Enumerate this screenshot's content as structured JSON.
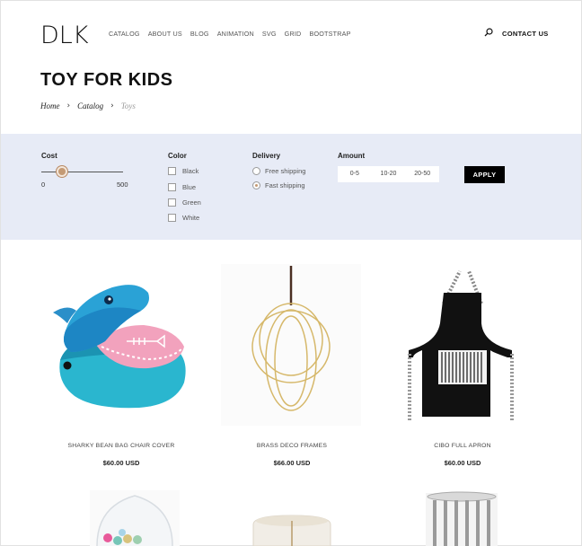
{
  "header": {
    "logo": "DLK",
    "nav": [
      "CATALOG",
      "ABOUT US",
      "BLOG",
      "ANIMATION",
      "SVG",
      "GRID",
      "BOOTSTRAP"
    ],
    "contact": "CONTACT US",
    "search_icon": "search-icon"
  },
  "page": {
    "title": "TOY FOR KIDS",
    "breadcrumb": [
      "Home",
      "Catalog",
      "Toys"
    ]
  },
  "filters": {
    "background": "#e7ebf6",
    "cost": {
      "label": "Cost",
      "min": "0",
      "max": "500",
      "value_fraction": 0.25,
      "accent": "#c49a74"
    },
    "color": {
      "label": "Color",
      "options": [
        "Black",
        "Blue",
        "Green",
        "White"
      ]
    },
    "delivery": {
      "label": "Delivery",
      "options": [
        "Free shipping",
        "Fast shipping"
      ],
      "selected": "Fast shipping"
    },
    "amount": {
      "label": "Amount",
      "options": [
        "0-5",
        "10-20",
        "20-50"
      ]
    },
    "apply": "APPLY"
  },
  "products": [
    {
      "name": "SHARKY BEAN BAG CHAIR COVER",
      "price": "$60.00 USD"
    },
    {
      "name": "BRASS DECO FRAMES",
      "price": "$66.00 USD"
    },
    {
      "name": "CIBO FULL APRON",
      "price": "$60.00 USD"
    }
  ]
}
